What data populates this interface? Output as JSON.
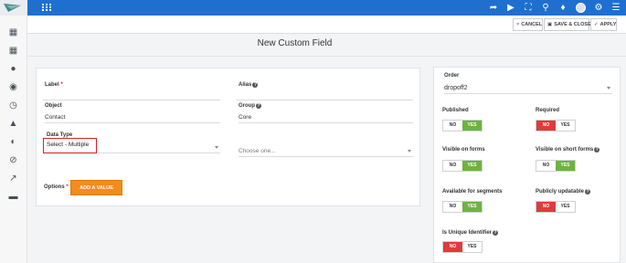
{
  "topbar": {
    "icons": [
      "grid-icon",
      "share-icon",
      "play-icon",
      "fullscreen-icon",
      "search-icon",
      "bell-icon",
      "avatar",
      "gear-icon",
      "menu-icon"
    ]
  },
  "sidebar": {
    "icons": [
      "dashboard-icon",
      "calendar-icon",
      "contacts-icon",
      "components-icon",
      "clock-icon",
      "points-icon",
      "channels-icon",
      "disabled-icon",
      "reports-icon",
      "chat-icon"
    ]
  },
  "toolbar": {
    "cancel": "CANCEL",
    "save_close": "SAVE & CLOSE",
    "apply": "APPLY"
  },
  "page": {
    "title": "New Custom Field"
  },
  "form": {
    "label_label": "Label",
    "alias_label": "Alias",
    "object_label": "Object",
    "object_value": "Contact",
    "group_label": "Group",
    "group_value": "Core",
    "data_type_label": "Data Type",
    "data_type_value": "Select - Multiple",
    "choose_placeholder": "Choose one...",
    "options_label": "Options",
    "add_value": "ADD A VALUE"
  },
  "settings": {
    "order_label": "Order",
    "order_value": "dropoff2",
    "no": "NO",
    "yes": "YES",
    "published_label": "Published",
    "required_label": "Required",
    "visible_forms_label": "Visible on forms",
    "visible_short_label": "Visible on short forms",
    "segments_label": "Available for segments",
    "publicly_label": "Publicly updatable",
    "unique_label": "Is Unique Identifier"
  },
  "colors": {
    "topbar": "#1f6fd0",
    "yes_active": "#6db33f",
    "no_active": "#e13a3a",
    "add_button": "#f28c1a",
    "highlight": "#d51f2b"
  }
}
